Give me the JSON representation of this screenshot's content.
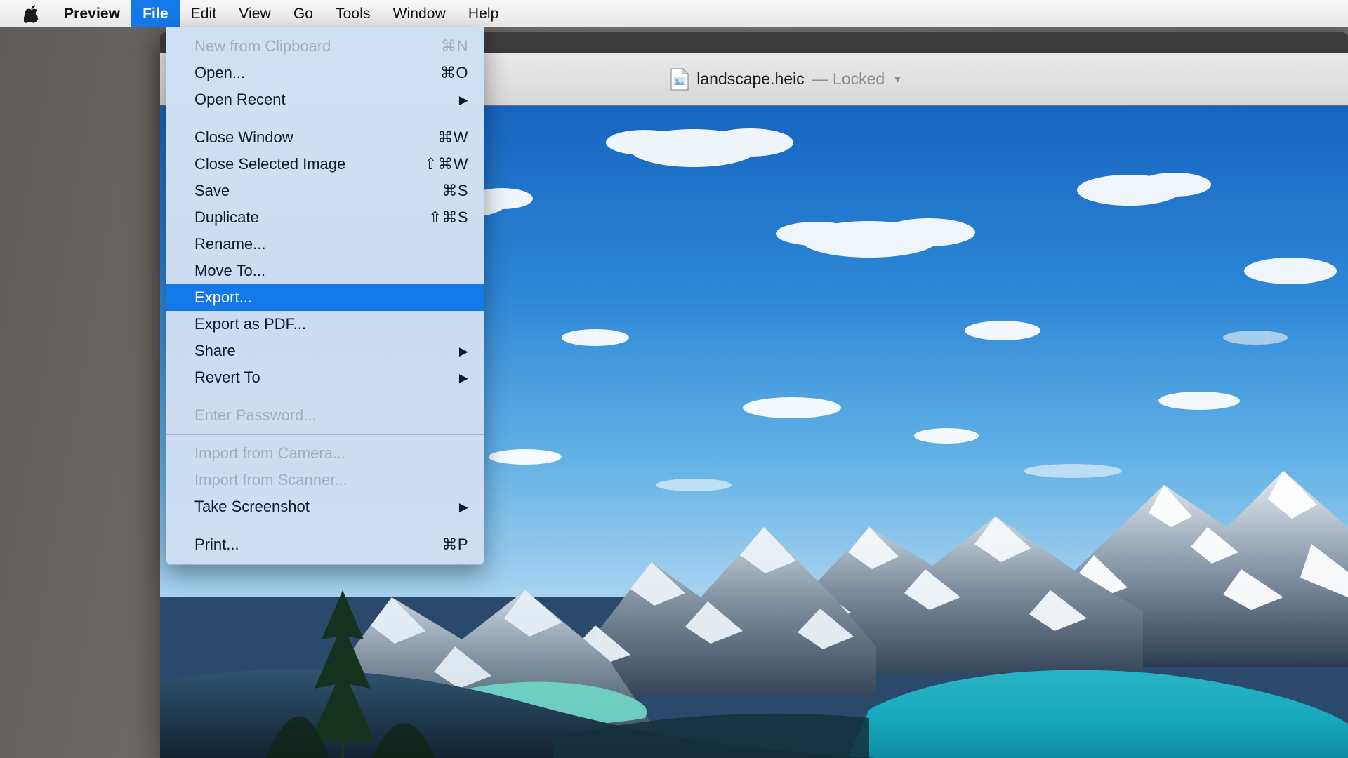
{
  "menubar": {
    "apple_icon": "apple-logo-icon",
    "items": [
      {
        "label": "Preview",
        "bold": true,
        "active": false
      },
      {
        "label": "File",
        "bold": true,
        "active": true
      },
      {
        "label": "Edit",
        "bold": false,
        "active": false
      },
      {
        "label": "View",
        "bold": false,
        "active": false
      },
      {
        "label": "Go",
        "bold": false,
        "active": false
      },
      {
        "label": "Tools",
        "bold": false,
        "active": false
      },
      {
        "label": "Window",
        "bold": false,
        "active": false
      },
      {
        "label": "Help",
        "bold": false,
        "active": false
      }
    ]
  },
  "window": {
    "doc_icon": "heic-document-icon",
    "doc_name": "landscape.heic",
    "doc_status": "— Locked",
    "title_chevron": "chevron-down-icon"
  },
  "file_menu": {
    "groups": [
      {
        "items": [
          {
            "label": "New from Clipboard",
            "shortcut": "⌘N",
            "disabled": true,
            "submenu": false,
            "highlight": false
          },
          {
            "label": "Open...",
            "shortcut": "⌘O",
            "disabled": false,
            "submenu": false,
            "highlight": false
          },
          {
            "label": "Open Recent",
            "shortcut": "",
            "disabled": false,
            "submenu": true,
            "highlight": false
          }
        ]
      },
      {
        "items": [
          {
            "label": "Close Window",
            "shortcut": "⌘W",
            "disabled": false,
            "submenu": false,
            "highlight": false
          },
          {
            "label": "Close Selected Image",
            "shortcut": "⇧⌘W",
            "disabled": false,
            "submenu": false,
            "highlight": false
          },
          {
            "label": "Save",
            "shortcut": "⌘S",
            "disabled": false,
            "submenu": false,
            "highlight": false
          },
          {
            "label": "Duplicate",
            "shortcut": "⇧⌘S",
            "disabled": false,
            "submenu": false,
            "highlight": false
          },
          {
            "label": "Rename...",
            "shortcut": "",
            "disabled": false,
            "submenu": false,
            "highlight": false
          },
          {
            "label": "Move To...",
            "shortcut": "",
            "disabled": false,
            "submenu": false,
            "highlight": false
          },
          {
            "label": "Export...",
            "shortcut": "",
            "disabled": false,
            "submenu": false,
            "highlight": true
          },
          {
            "label": "Export as PDF...",
            "shortcut": "",
            "disabled": false,
            "submenu": false,
            "highlight": false
          },
          {
            "label": "Share",
            "shortcut": "",
            "disabled": false,
            "submenu": true,
            "highlight": false
          },
          {
            "label": "Revert To",
            "shortcut": "",
            "disabled": false,
            "submenu": true,
            "highlight": false
          }
        ]
      },
      {
        "items": [
          {
            "label": "Enter Password...",
            "shortcut": "",
            "disabled": true,
            "submenu": false,
            "highlight": false
          }
        ]
      },
      {
        "items": [
          {
            "label": "Import from Camera...",
            "shortcut": "",
            "disabled": true,
            "submenu": false,
            "highlight": false
          },
          {
            "label": "Import from Scanner...",
            "shortcut": "",
            "disabled": true,
            "submenu": false,
            "highlight": false
          },
          {
            "label": "Take Screenshot",
            "shortcut": "",
            "disabled": false,
            "submenu": true,
            "highlight": false
          }
        ]
      },
      {
        "items": [
          {
            "label": "Print...",
            "shortcut": "⌘P",
            "disabled": false,
            "submenu": false,
            "highlight": false
          }
        ]
      }
    ]
  },
  "colors": {
    "menu_highlight": "#1478e8",
    "menubar_bg": "#f0f0f0",
    "menu_bg": "#cddef3",
    "desktop_bg": "#6e6b68",
    "titlebar_bg": "#e2e2e2"
  },
  "photo": {
    "description": "mountain-lake-landscape-photo",
    "sky": "#2e8ad8",
    "water": "#1fb7c4",
    "snow": "#f2f6f9",
    "forest": "#1d3b2a"
  }
}
